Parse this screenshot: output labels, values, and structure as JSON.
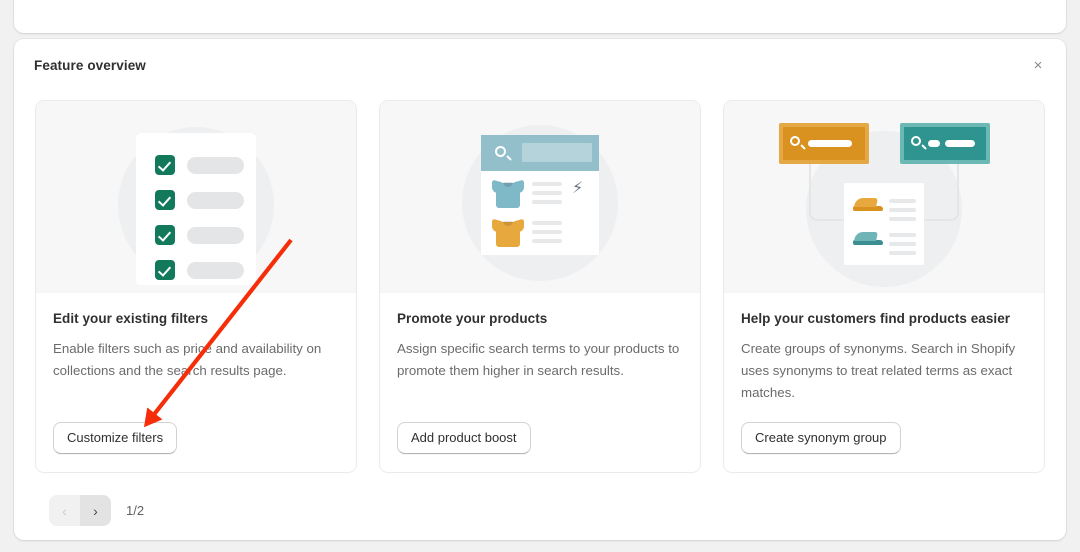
{
  "header": {
    "title": "Feature overview",
    "close_icon": "close-icon",
    "close_label": "×"
  },
  "features": [
    {
      "illustration": "checklist-filters-illustration",
      "heading": "Edit your existing filters",
      "description": "Enable filters such as price and availability on collections and the search results page.",
      "button_label": "Customize filters"
    },
    {
      "illustration": "search-results-boost-illustration",
      "heading": "Promote your products",
      "description": "Assign specific search terms to your products to promote them higher in search results.",
      "button_label": "Add product boost"
    },
    {
      "illustration": "synonyms-search-illustration",
      "heading": "Help your customers find products easier",
      "description": "Create groups of synonyms. Search in Shopify uses synonyms to treat related terms as exact matches.",
      "button_label": "Create synonym group"
    }
  ],
  "pagination": {
    "previous_icon": "chevron-left-icon",
    "previous_label": "‹",
    "next_icon": "chevron-right-icon",
    "next_label": "›",
    "page_indicator": "1/2"
  },
  "colors": {
    "checkbox_green": "#127a5b",
    "search_bar_blue": "#93bfca",
    "shirt_blue": "#7fb8c6",
    "shirt_orange": "#e7a93e",
    "synonym_box_orange": "#d9921f",
    "synonym_box_orange_border": "#e4a944",
    "synonym_box_teal": "#2f9490",
    "synonym_box_teal_border": "#6bb8b4",
    "annotation_red": "#f52d09",
    "card_background": "#ffffff",
    "page_background": "#f1f1f1",
    "tile_illustration_background": "#f7f7f7"
  }
}
